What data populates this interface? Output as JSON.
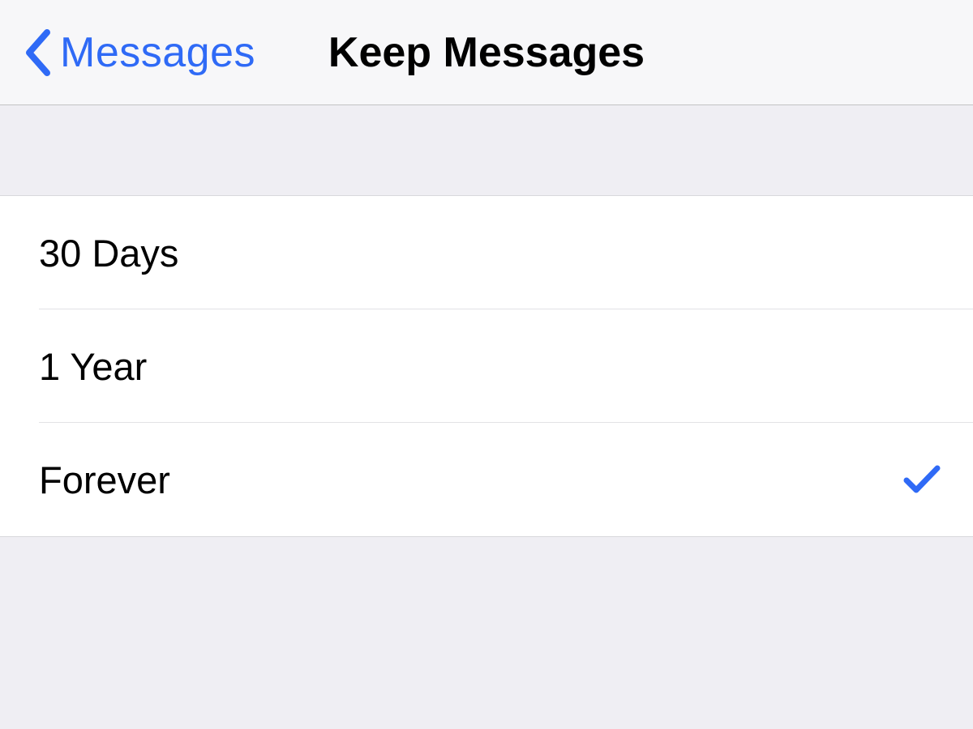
{
  "navbar": {
    "back_label": "Messages",
    "title": "Keep Messages"
  },
  "options": [
    {
      "label": "30 Days",
      "selected": false
    },
    {
      "label": "1 Year",
      "selected": false
    },
    {
      "label": "Forever",
      "selected": true
    }
  ],
  "colors": {
    "accent": "#2f6af6"
  }
}
